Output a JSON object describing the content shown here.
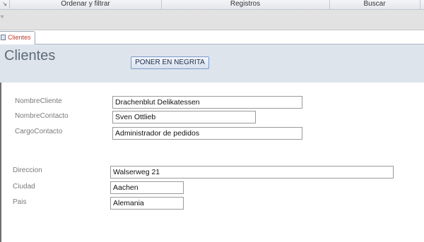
{
  "ribbon": {
    "groups": [
      "Ordenar y filtrar",
      "Registros",
      "Buscar"
    ]
  },
  "tab": {
    "label": "Clientes"
  },
  "header": {
    "title": "Clientes",
    "bold_button": "PONER EN NEGRITA"
  },
  "fields": {
    "nombre_cliente": {
      "label": "NombreCliente",
      "value": "Drachenblut Delikatessen"
    },
    "nombre_contacto": {
      "label": "NombreContacto",
      "value": "Sven Ottlieb"
    },
    "cargo_contacto": {
      "label": "CargoContacto",
      "value": "Administrador de pedidos"
    },
    "direccion": {
      "label": "Direccion",
      "value": "Walserweg 21"
    },
    "ciudad": {
      "label": "Ciudad",
      "value": "Aachen"
    },
    "pais": {
      "label": "Pais",
      "value": "Alemania"
    }
  }
}
